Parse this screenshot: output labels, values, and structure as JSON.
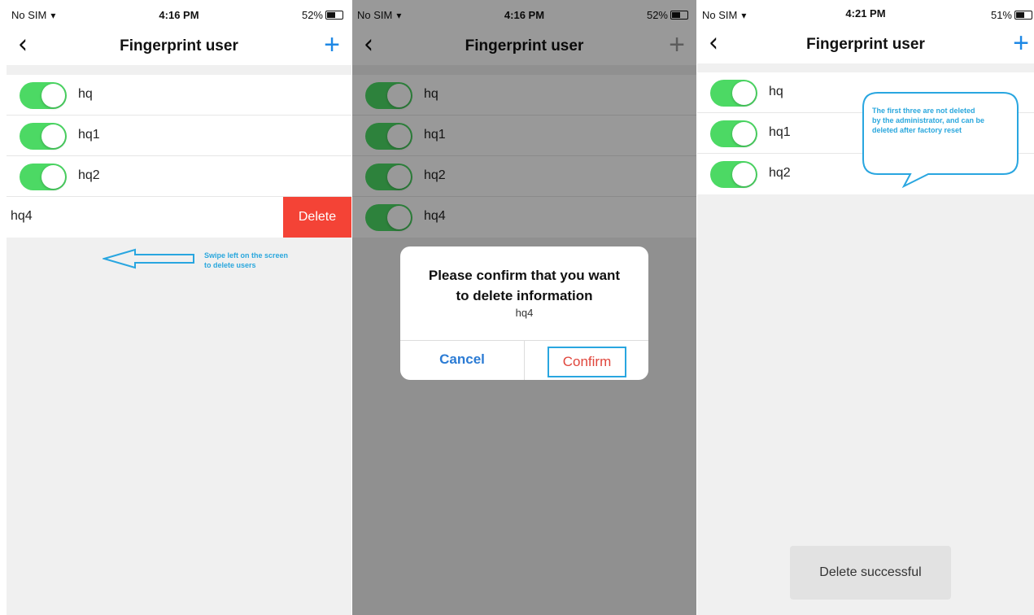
{
  "panels": [
    {
      "status": {
        "carrier": "No SIM",
        "time": "4:16 PM",
        "battery": "52%"
      },
      "title": "Fingerprint user",
      "users": [
        "hq",
        "hq1",
        "hq2"
      ],
      "swiped_user": "hq4",
      "delete_label": "Delete",
      "hint": {
        "line1": "Swipe left on the screen",
        "line2": "to delete users"
      }
    },
    {
      "status": {
        "carrier": "No SIM",
        "time": "4:16 PM",
        "battery": "52%"
      },
      "title": "Fingerprint user",
      "users": [
        "hq",
        "hq1",
        "hq2",
        "hq4"
      ],
      "dialog": {
        "title_line1": "Please confirm that you want",
        "title_line2": "to delete information",
        "subtitle": "hq4",
        "cancel": "Cancel",
        "confirm": "Confirm"
      }
    },
    {
      "status": {
        "carrier": "No SIM",
        "time": "4:21 PM",
        "battery": "51%"
      },
      "title": "Fingerprint user",
      "users": [
        "hq",
        "hq1",
        "hq2"
      ],
      "callout": {
        "line1": "The first three are not deleted",
        "line2": "by the administrator, and can be",
        "line3": "deleted after factory reset"
      },
      "toast": "Delete successful"
    }
  ],
  "colors": {
    "accent": "#1e88e5",
    "toggle_on": "#4cd964",
    "delete": "#f44336",
    "annotation": "#29a6e0"
  },
  "icons": {
    "back": "chevron-left-icon",
    "add": "plus-icon",
    "wifi": "wifi-icon",
    "battery": "battery-icon"
  }
}
